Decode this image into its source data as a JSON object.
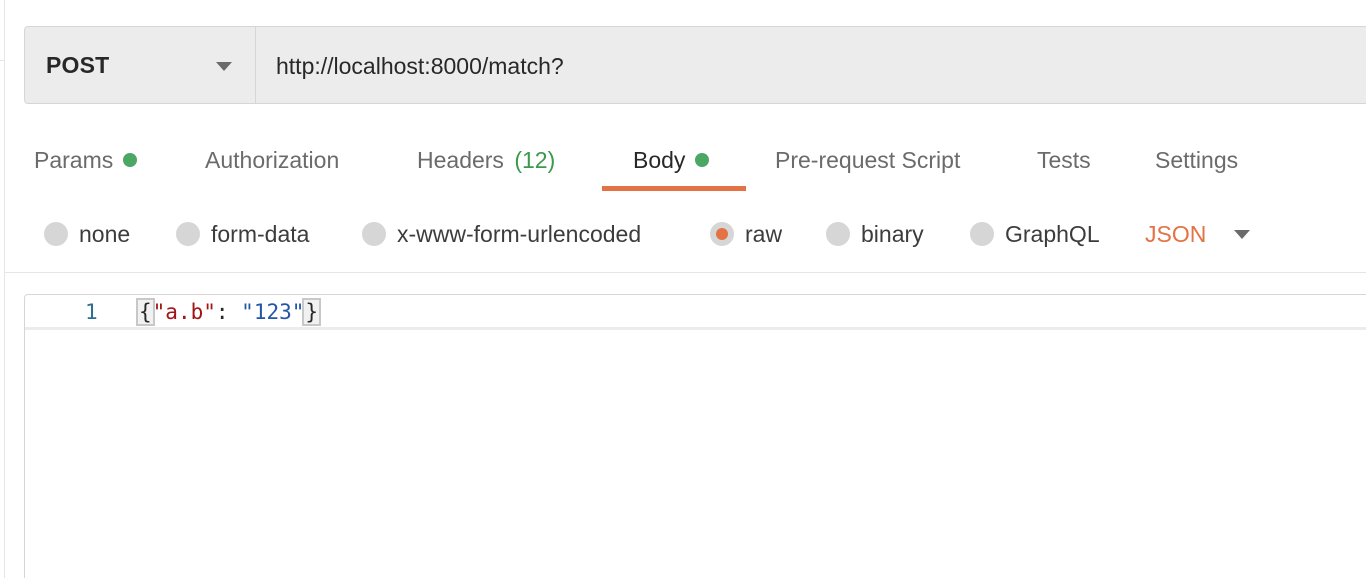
{
  "request": {
    "method": "POST",
    "url": "http://localhost:8000/match?"
  },
  "tabs": [
    {
      "label": "Params",
      "has_dot": true
    },
    {
      "label": "Authorization"
    },
    {
      "label": "Headers",
      "count": "(12)"
    },
    {
      "label": "Body",
      "has_dot": true,
      "active": true
    },
    {
      "label": "Pre-request Script"
    },
    {
      "label": "Tests"
    },
    {
      "label": "Settings"
    }
  ],
  "body_modes": [
    {
      "label": "none",
      "checked": false
    },
    {
      "label": "form-data",
      "checked": false
    },
    {
      "label": "x-www-form-urlencoded",
      "checked": false
    },
    {
      "label": "raw",
      "checked": true
    },
    {
      "label": "binary",
      "checked": false
    },
    {
      "label": "GraphQL",
      "checked": false
    }
  ],
  "language": "JSON",
  "editor": {
    "line_number": "1",
    "open_brace": "{",
    "key": "\"a.b\"",
    "colon": ": ",
    "value": "\"123\"",
    "close_brace": "}"
  },
  "colors": {
    "accent": "#e37244",
    "dot_green": "#4aa764",
    "count_green": "#3a9a4c"
  },
  "icons": [
    "chevron-down-icon"
  ]
}
